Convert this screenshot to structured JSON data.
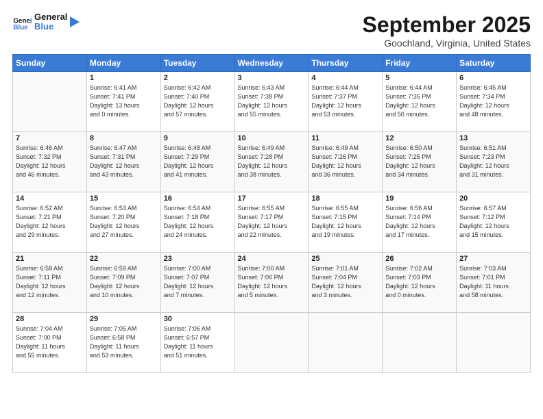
{
  "header": {
    "logo_line1": "General",
    "logo_line2": "Blue",
    "month_title": "September 2025",
    "location": "Goochland, Virginia, United States"
  },
  "weekdays": [
    "Sunday",
    "Monday",
    "Tuesday",
    "Wednesday",
    "Thursday",
    "Friday",
    "Saturday"
  ],
  "weeks": [
    [
      {
        "day": "",
        "info": ""
      },
      {
        "day": "1",
        "info": "Sunrise: 6:41 AM\nSunset: 7:41 PM\nDaylight: 13 hours\nand 0 minutes."
      },
      {
        "day": "2",
        "info": "Sunrise: 6:42 AM\nSunset: 7:40 PM\nDaylight: 12 hours\nand 57 minutes."
      },
      {
        "day": "3",
        "info": "Sunrise: 6:43 AM\nSunset: 7:38 PM\nDaylight: 12 hours\nand 55 minutes."
      },
      {
        "day": "4",
        "info": "Sunrise: 6:44 AM\nSunset: 7:37 PM\nDaylight: 12 hours\nand 53 minutes."
      },
      {
        "day": "5",
        "info": "Sunrise: 6:44 AM\nSunset: 7:35 PM\nDaylight: 12 hours\nand 50 minutes."
      },
      {
        "day": "6",
        "info": "Sunrise: 6:45 AM\nSunset: 7:34 PM\nDaylight: 12 hours\nand 48 minutes."
      }
    ],
    [
      {
        "day": "7",
        "info": "Sunrise: 6:46 AM\nSunset: 7:32 PM\nDaylight: 12 hours\nand 46 minutes."
      },
      {
        "day": "8",
        "info": "Sunrise: 6:47 AM\nSunset: 7:31 PM\nDaylight: 12 hours\nand 43 minutes."
      },
      {
        "day": "9",
        "info": "Sunrise: 6:48 AM\nSunset: 7:29 PM\nDaylight: 12 hours\nand 41 minutes."
      },
      {
        "day": "10",
        "info": "Sunrise: 6:49 AM\nSunset: 7:28 PM\nDaylight: 12 hours\nand 38 minutes."
      },
      {
        "day": "11",
        "info": "Sunrise: 6:49 AM\nSunset: 7:26 PM\nDaylight: 12 hours\nand 36 minutes."
      },
      {
        "day": "12",
        "info": "Sunrise: 6:50 AM\nSunset: 7:25 PM\nDaylight: 12 hours\nand 34 minutes."
      },
      {
        "day": "13",
        "info": "Sunrise: 6:51 AM\nSunset: 7:23 PM\nDaylight: 12 hours\nand 31 minutes."
      }
    ],
    [
      {
        "day": "14",
        "info": "Sunrise: 6:52 AM\nSunset: 7:21 PM\nDaylight: 12 hours\nand 29 minutes."
      },
      {
        "day": "15",
        "info": "Sunrise: 6:53 AM\nSunset: 7:20 PM\nDaylight: 12 hours\nand 27 minutes."
      },
      {
        "day": "16",
        "info": "Sunrise: 6:54 AM\nSunset: 7:18 PM\nDaylight: 12 hours\nand 24 minutes."
      },
      {
        "day": "17",
        "info": "Sunrise: 6:55 AM\nSunset: 7:17 PM\nDaylight: 12 hours\nand 22 minutes."
      },
      {
        "day": "18",
        "info": "Sunrise: 6:55 AM\nSunset: 7:15 PM\nDaylight: 12 hours\nand 19 minutes."
      },
      {
        "day": "19",
        "info": "Sunrise: 6:56 AM\nSunset: 7:14 PM\nDaylight: 12 hours\nand 17 minutes."
      },
      {
        "day": "20",
        "info": "Sunrise: 6:57 AM\nSunset: 7:12 PM\nDaylight: 12 hours\nand 15 minutes."
      }
    ],
    [
      {
        "day": "21",
        "info": "Sunrise: 6:58 AM\nSunset: 7:11 PM\nDaylight: 12 hours\nand 12 minutes."
      },
      {
        "day": "22",
        "info": "Sunrise: 6:59 AM\nSunset: 7:09 PM\nDaylight: 12 hours\nand 10 minutes."
      },
      {
        "day": "23",
        "info": "Sunrise: 7:00 AM\nSunset: 7:07 PM\nDaylight: 12 hours\nand 7 minutes."
      },
      {
        "day": "24",
        "info": "Sunrise: 7:00 AM\nSunset: 7:06 PM\nDaylight: 12 hours\nand 5 minutes."
      },
      {
        "day": "25",
        "info": "Sunrise: 7:01 AM\nSunset: 7:04 PM\nDaylight: 12 hours\nand 3 minutes."
      },
      {
        "day": "26",
        "info": "Sunrise: 7:02 AM\nSunset: 7:03 PM\nDaylight: 12 hours\nand 0 minutes."
      },
      {
        "day": "27",
        "info": "Sunrise: 7:03 AM\nSunset: 7:01 PM\nDaylight: 11 hours\nand 58 minutes."
      }
    ],
    [
      {
        "day": "28",
        "info": "Sunrise: 7:04 AM\nSunset: 7:00 PM\nDaylight: 11 hours\nand 55 minutes."
      },
      {
        "day": "29",
        "info": "Sunrise: 7:05 AM\nSunset: 6:58 PM\nDaylight: 11 hours\nand 53 minutes."
      },
      {
        "day": "30",
        "info": "Sunrise: 7:06 AM\nSunset: 6:57 PM\nDaylight: 11 hours\nand 51 minutes."
      },
      {
        "day": "",
        "info": ""
      },
      {
        "day": "",
        "info": ""
      },
      {
        "day": "",
        "info": ""
      },
      {
        "day": "",
        "info": ""
      }
    ]
  ]
}
